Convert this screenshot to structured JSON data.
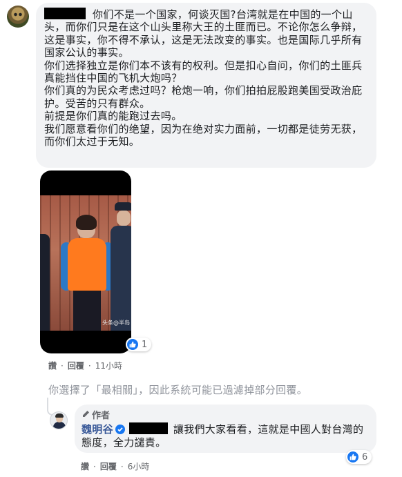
{
  "comment1": {
    "text": "你们不是一个国家，何谈灭国?台湾就是在中国的一个山头，而你们只是在这个山头里称大王的土匪而已。不论你怎么争辩，这是事实，你不得不承认，这是无法改变的事实。也是国际几乎所有国家公认的事实。\n你们选择独立是你们本不该有的权利。但是扣心自问，你们的土匪兵真能挡住中国的飞机大炮吗？\n你们真的为民众考虑过吗？枪炮一响，你们拍拍屁股跑美国受政治庇护。受苦的只有群众。\n前提是你们真的能跑过去吗。\n我们愿意看你们的绝望，因为在绝对实力面前，一切都是徒劳无获，而你们太过于无知。",
    "photo_watermark": "头条@半岛",
    "reaction_count": "1",
    "actions": {
      "like": "讚",
      "reply": "回覆",
      "time": "11小時"
    }
  },
  "filter_note": "你選擇了「最相關」，因此系統可能已過濾掉部分回覆。",
  "reply1": {
    "author_tag": "作者",
    "name": "魏明谷",
    "text": "讓我們大家看看，這就是中國人對台灣的態度，全力譴責。",
    "reaction_count": "6",
    "actions": {
      "like": "讚",
      "reply": "回覆",
      "time": "6小時"
    }
  },
  "colors": {
    "facebook_blue": "#1877f2",
    "name_link": "#385898",
    "bubble": "#f2f3f5",
    "meta_gray": "#65676b"
  },
  "icons": {
    "reaction": "like-icon",
    "verified": "verified-icon",
    "author": "pen-icon"
  }
}
